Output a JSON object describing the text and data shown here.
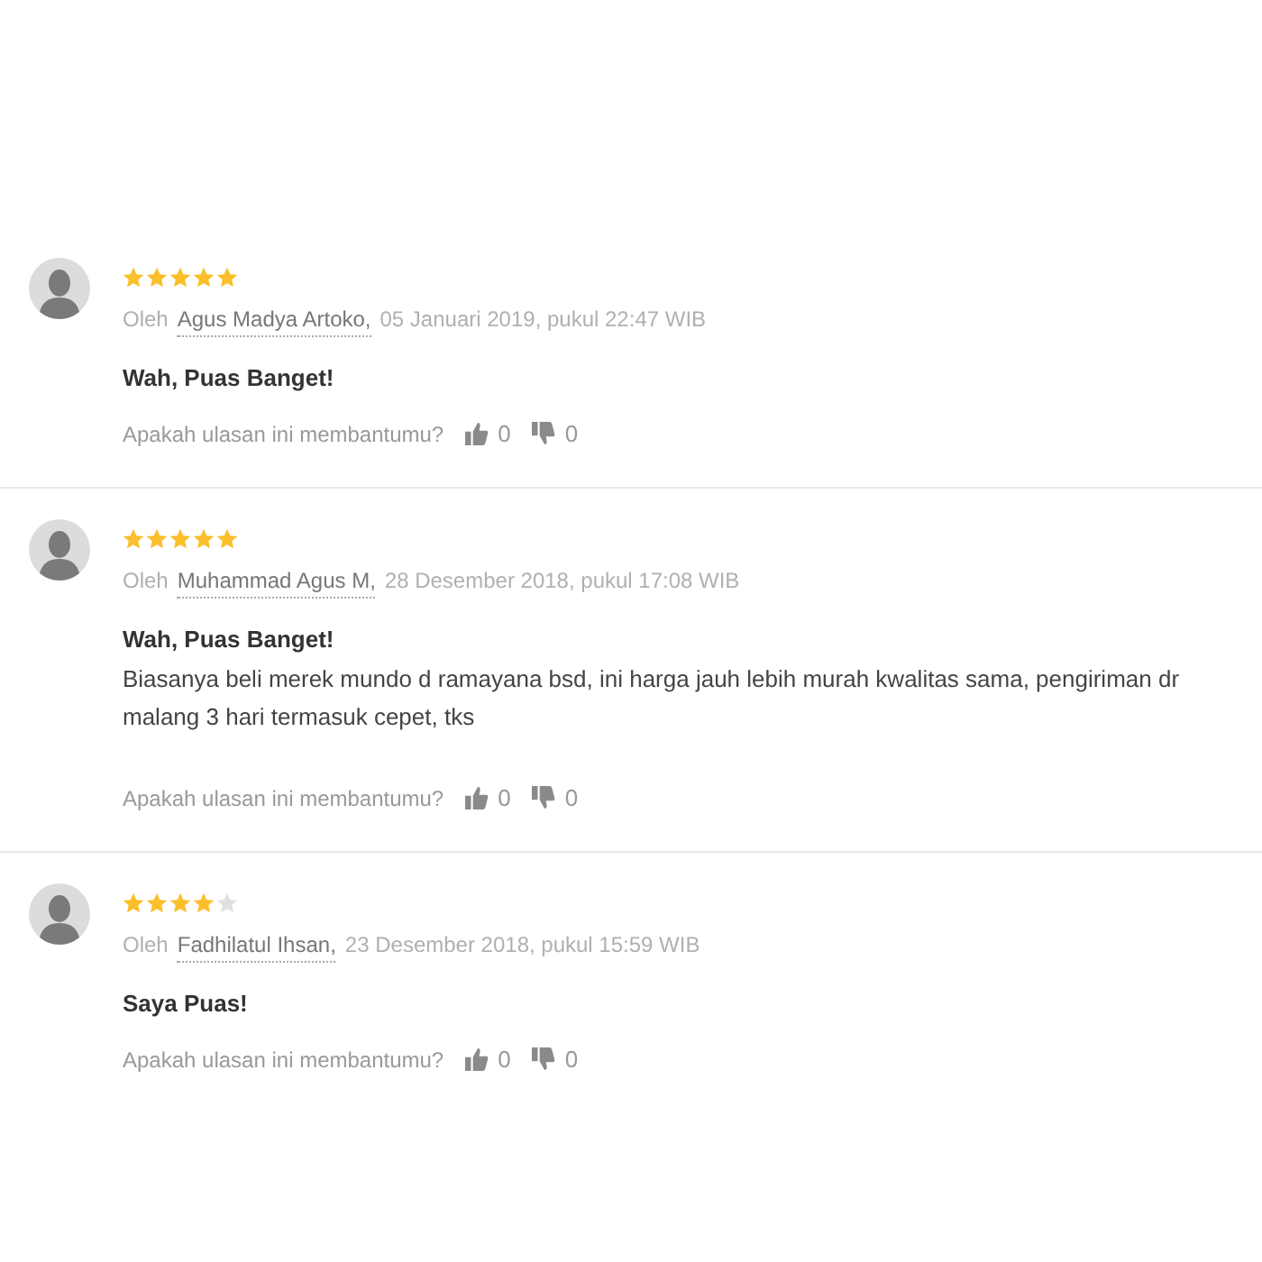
{
  "reviews": [
    {
      "stars": 5,
      "by": "Oleh",
      "author": "Agus Madya Artoko,",
      "date": "05 Januari 2019, pukul 22:47 WIB",
      "title": "Wah, Puas Banget!",
      "helpful_question": "Apakah ulasan ini membantumu?",
      "likes": "0",
      "dislikes": "0"
    },
    {
      "stars": 5,
      "by": "Oleh",
      "author": "Muhammad Agus M,",
      "date": "28 Desember 2018, pukul 17:08 WIB",
      "title": "Wah, Puas Banget!",
      "body": "Biasanya beli merek mundo d ramayana bsd, ini harga jauh lebih murah kwalitas sama, pengiriman dr malang 3 hari termasuk cepet, tks",
      "helpful_question": "Apakah ulasan ini membantumu?",
      "likes": "0",
      "dislikes": "0"
    },
    {
      "stars": 4,
      "by": "Oleh",
      "author": "Fadhilatul Ihsan,",
      "date": "23 Desember 2018, pukul 15:59 WIB",
      "title": "Saya Puas!",
      "helpful_question": "Apakah ulasan ini membantumu?",
      "likes": "0",
      "dislikes": "0"
    }
  ]
}
